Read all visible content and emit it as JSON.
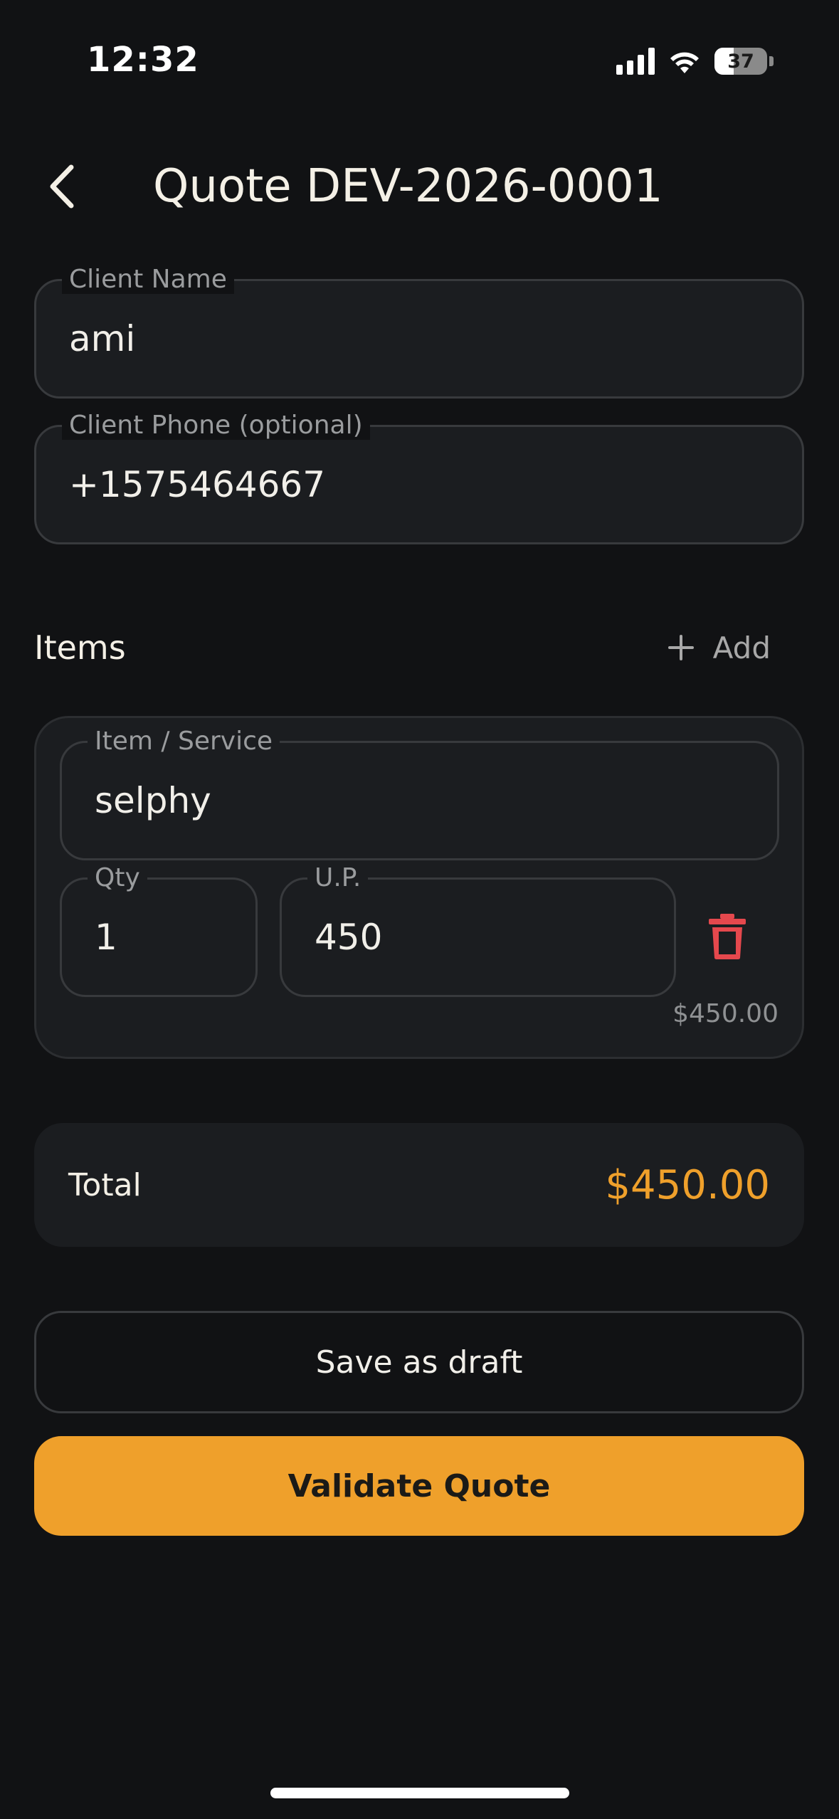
{
  "status_bar": {
    "time": "12:32",
    "battery_percent": "37",
    "battery_level": 0.37
  },
  "header": {
    "title": "Quote DEV-2026-0001"
  },
  "client": {
    "name_label": "Client Name",
    "name_value": "ami",
    "phone_label": "Client Phone (optional)",
    "phone_value": "+1575464667"
  },
  "items_section": {
    "title": "Items",
    "add_label": "Add"
  },
  "item": {
    "service_label": "Item / Service",
    "service_value": "selphy",
    "qty_label": "Qty",
    "qty_value": "1",
    "unit_price_label": "U.P.",
    "unit_price_value": "450",
    "line_total": "$450.00"
  },
  "total": {
    "label": "Total",
    "value": "$450.00"
  },
  "actions": {
    "draft_label": "Save as draft",
    "validate_label": "Validate Quote"
  },
  "colors": {
    "accent": "#efa02b",
    "danger": "#e5484d",
    "background": "#111214",
    "surface": "#1b1d20"
  }
}
